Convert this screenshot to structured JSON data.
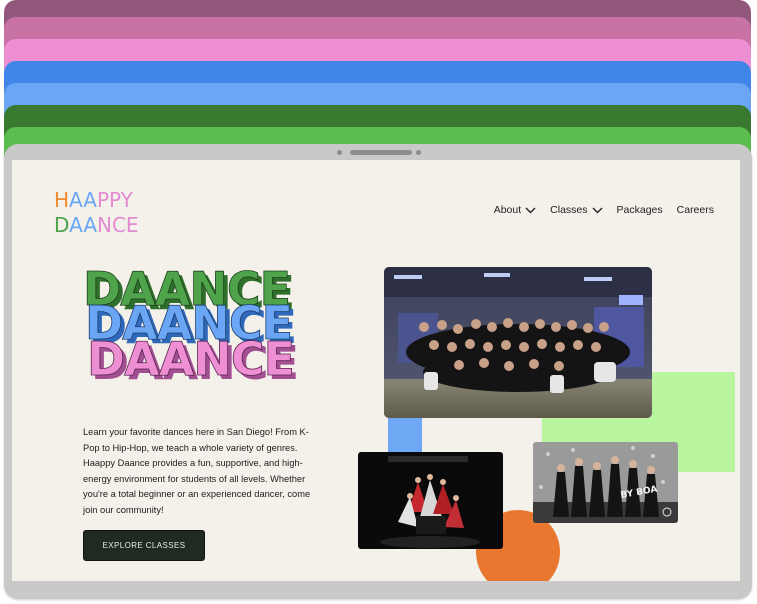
{
  "logo": {
    "line1": "HAAPPY",
    "line2": "DAANCE"
  },
  "nav": {
    "items": [
      {
        "label": "About",
        "has_dropdown": true
      },
      {
        "label": "Classes",
        "has_dropdown": true
      },
      {
        "label": "Packages",
        "has_dropdown": false
      },
      {
        "label": "Careers",
        "has_dropdown": false
      }
    ]
  },
  "hero": {
    "title_lines": [
      "DAANCE",
      "DAANCE",
      "DAANCE"
    ],
    "description": "Learn your favorite dances here in San Diego! From K-Pop to Hip-Hop, we teach a whole variety of genres. Haappy Daance provides a fun, supportive, and high-energy environment for students of all levels. Whether you're a total beginner or an experienced dancer, come join our community!",
    "cta_label": "EXPLORE CLASSES"
  },
  "colors": {
    "stack": [
      "#92587c",
      "#c972a6",
      "#ee8fd3",
      "#3f86e8",
      "#6aa6f4",
      "#3a7a30",
      "#5cbd4f"
    ],
    "green_title": "#4fa34a",
    "blue_title": "#5e9df2",
    "pink_title": "#e38bd0",
    "light_green_square": "#b8f59e",
    "blue_square": "#6ea7f4",
    "orange_circle": "#e9772f",
    "button_bg": "#1f2a22",
    "screen_bg": "#f3f1ea"
  },
  "photos": {
    "main": "group-photo-dance-studio",
    "left": "stage-performance-photo",
    "right": "dance-crew-pose-photo",
    "right_caption_graffiti": "BY BOA"
  }
}
